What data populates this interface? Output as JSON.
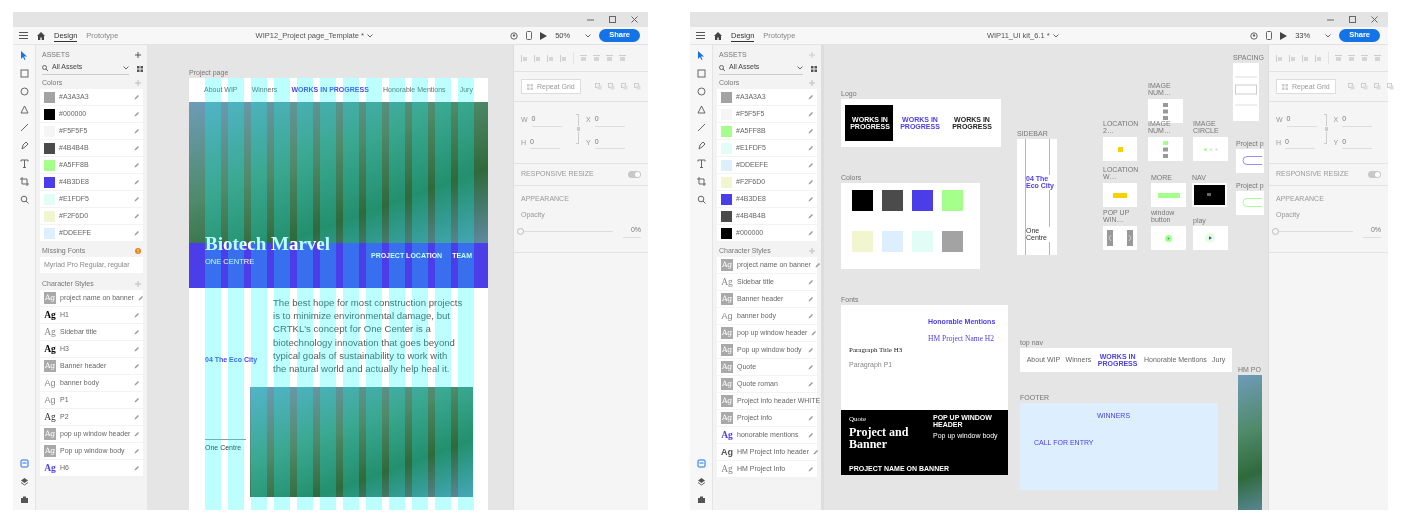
{
  "windows": [
    {
      "file_title": "WIP12_Project page_Template *",
      "zoom": "50%",
      "share": "Share",
      "tabs": [
        {
          "label": "Design",
          "selected": true
        },
        {
          "label": "Prototype",
          "selected": false
        }
      ],
      "assets": {
        "heading": "ASSETS",
        "filter": "All Assets",
        "colors_heading": "Colors",
        "colors": [
          {
            "label": "#A3A3A3",
            "color": "#a3a3a3"
          },
          {
            "label": "#000000",
            "color": "#000000"
          },
          {
            "label": "#F5F5F5",
            "color": "#f5f5f5"
          },
          {
            "label": "#4B4B4B",
            "color": "#4b4b4b"
          },
          {
            "label": "#A5FF8B",
            "color": "#a5ff8b"
          },
          {
            "label": "#4B3DE8",
            "color": "#4b3de8"
          },
          {
            "label": "#E1FDF5",
            "color": "#e1fdf5"
          },
          {
            "label": "#F2F6D0",
            "color": "#f2f6d0"
          },
          {
            "label": "#DDEEFE",
            "color": "#ddeefe"
          }
        ],
        "missing_fonts": {
          "heading": "Missing Fonts",
          "font": "Myriad Pro Regular, regular"
        },
        "styles_heading": "Character Styles",
        "styles": [
          {
            "preview": "Ag",
            "label": "project name on banner",
            "kind": "white"
          },
          {
            "preview": "Ag",
            "label": "H1",
            "kind": "serif-bold"
          },
          {
            "preview": "Ag",
            "label": "Sidebar title",
            "kind": "serif-light"
          },
          {
            "preview": "Ag",
            "label": "H3",
            "kind": "serif-bold"
          },
          {
            "preview": "Ag",
            "label": "Banner header",
            "kind": "white"
          },
          {
            "preview": "Ag",
            "label": "banner body",
            "kind": "sans-light"
          },
          {
            "preview": "Ag",
            "label": "P1",
            "kind": "sans-light"
          },
          {
            "preview": "Ag",
            "label": "P2",
            "kind": "serif"
          },
          {
            "preview": "Ag",
            "label": "pop up window header",
            "kind": "white"
          },
          {
            "preview": "Ag",
            "label": "Pop up window body",
            "kind": "white"
          },
          {
            "preview": "Ag",
            "label": "H6",
            "kind": "serif-blue"
          }
        ]
      },
      "properties": {
        "repeat_grid": "Repeat Grid",
        "fields": [
          {
            "label": "W",
            "value": "0"
          },
          {
            "label": "X",
            "value": "0"
          },
          {
            "label": "H",
            "value": "0"
          },
          {
            "label": "Y",
            "value": "0"
          }
        ],
        "responsive": {
          "label": "RESPONSIVE RESIZE",
          "on": true
        },
        "appearance": "APPEARANCE",
        "opacity": {
          "label": "Opacity",
          "value": "0%",
          "level": 0
        }
      },
      "canvas": {
        "kind": "project-page",
        "artboard_label": "Project page",
        "nav": [
          {
            "label": "About WIP",
            "kind": "link"
          },
          {
            "label": "Winners",
            "kind": "link"
          },
          {
            "label": "WORKS IN PROGRESS",
            "kind": "logo"
          },
          {
            "label": "Honorable Mentions",
            "kind": "link"
          },
          {
            "label": "Jury",
            "kind": "link"
          }
        ],
        "title": "Biotech Marvel",
        "subtitle": "ONE CENTRE",
        "info_headings": [
          "PROJECT LOCATION",
          "TEAM"
        ],
        "paragraph": "The best hope for most construction projects is to minimize environmental damage, but CRTKL's concept for One Center is a biotechnology innovation that goes beyond typical goals of sustainability to work with the natural world and actually help heal it.",
        "sidebar": [
          {
            "label": "04 The Eco City",
            "selected": true
          }
        ],
        "caption": "One Centre"
      }
    },
    {
      "file_title": "WIP11_UI kit_6.1 *",
      "zoom": "33%",
      "share": "Share",
      "tabs": [
        {
          "label": "Design",
          "selected": true
        },
        {
          "label": "Prototype",
          "selected": false
        }
      ],
      "assets": {
        "heading": "ASSETS",
        "filter": "All Assets",
        "colors_heading": "Colors",
        "colors": [
          {
            "label": "#A3A3A3",
            "color": "#a3a3a3"
          },
          {
            "label": "#F5F5F5",
            "color": "#f5f5f5"
          },
          {
            "label": "#A5FF8B",
            "color": "#a5ff8b"
          },
          {
            "label": "#E1FDF5",
            "color": "#e1fdf5"
          },
          {
            "label": "#DDEEFE",
            "color": "#ddeefe"
          },
          {
            "label": "#F2F6D0",
            "color": "#f2f6d0"
          },
          {
            "label": "#4B3DE8",
            "color": "#4b3de8"
          },
          {
            "label": "#4B4B4B",
            "color": "#4b4b4b"
          },
          {
            "label": "#000000",
            "color": "#000000"
          }
        ],
        "styles_heading": "Character Styles",
        "styles": [
          {
            "preview": "Ag",
            "label": "project name on banner",
            "kind": "white"
          },
          {
            "preview": "Ag",
            "label": "Sidebar title",
            "kind": "serif-light"
          },
          {
            "preview": "Ag",
            "label": "Banner header",
            "kind": "white"
          },
          {
            "preview": "Ag",
            "label": "banner body",
            "kind": "sans-light"
          },
          {
            "preview": "Ag",
            "label": "pop up window header",
            "kind": "white"
          },
          {
            "preview": "Ag",
            "label": "Pop up window body",
            "kind": "white"
          },
          {
            "preview": "Ag",
            "label": "Quote",
            "kind": "white"
          },
          {
            "preview": "Ag",
            "label": "Quote roman",
            "kind": "white"
          },
          {
            "preview": "Ag",
            "label": "Project info header WHITE",
            "kind": "white"
          },
          {
            "preview": "Ag",
            "label": "Project info",
            "kind": "white"
          },
          {
            "preview": "Ag",
            "label": "honorable mentions",
            "kind": "serif-blue"
          },
          {
            "preview": "Ag",
            "label": "HM Project Info header",
            "kind": "sans-dark"
          },
          {
            "preview": "Ag",
            "label": "HM Project Info",
            "kind": "serif-light"
          }
        ]
      },
      "properties": {
        "repeat_grid": "Repeat Grid",
        "fields": [
          {
            "label": "W",
            "value": "0"
          },
          {
            "label": "X",
            "value": "0"
          },
          {
            "label": "H",
            "value": "0"
          },
          {
            "label": "Y",
            "value": "0"
          }
        ],
        "responsive": {
          "label": "RESPONSIVE RESIZE",
          "on": true
        },
        "appearance": "APPEARANCE",
        "opacity": {
          "label": "Opacity",
          "value": "0%",
          "level": 0
        }
      },
      "canvas": {
        "kind": "ui-kit",
        "artboards": [
          {
            "kind": "logo",
            "label": "Logo",
            "logos": [
              "WORKS IN PROGRESS",
              "WORKS IN PROGRESS",
              "WORKS IN PROGRESS"
            ]
          },
          {
            "kind": "colors",
            "label": "Colors",
            "swatches": [
              {
                "color": "#000000"
              },
              {
                "color": "#4b4b4b"
              },
              {
                "color": "#4b3de8"
              },
              {
                "color": "#a5ff8b"
              },
              {
                "color": "#f2f6d0"
              },
              {
                "color": "#ddeefe"
              },
              {
                "color": "#e1fdf5"
              },
              {
                "color": "#a3a3a3"
              }
            ]
          },
          {
            "kind": "fonts",
            "label": "Fonts",
            "mentions": "Honorable Mentions",
            "hm_title": "HM Project Name H2",
            "h3": "Paragraph Title H3",
            "p1": "Paragraph P1",
            "quote": "Quote",
            "banner": "Project and Banner",
            "banner_sub": "PROJECT NAME ON BANNER",
            "popup_header": "POP UP WINDOW HEADER",
            "popup_body": "Pop up window body"
          },
          {
            "kind": "sidebar",
            "label": "SIDEBAR",
            "item": "04 The Eco City",
            "caption": "One Centre"
          },
          {
            "kind": "image-num",
            "label": "IMAGE NUM…"
          },
          {
            "kind": "location",
            "label": "LOCATION 2…"
          },
          {
            "kind": "image-num-active",
            "label": "IMAGE NUM…"
          },
          {
            "kind": "image-circle",
            "label": "IMAGE CIRCLE"
          },
          {
            "kind": "location-wide",
            "label": "LOCATION W…"
          },
          {
            "kind": "more",
            "label": "MORE"
          },
          {
            "kind": "nav",
            "label": "NAV"
          },
          {
            "kind": "popup",
            "label": "POP UP WIN…"
          },
          {
            "kind": "window-button",
            "label": "window button"
          },
          {
            "kind": "play",
            "label": "play"
          },
          {
            "kind": "topnav",
            "label": "top nav",
            "items": [
              "About WIP",
              "Winners",
              "WORKS IN PROGRESS",
              "Honorable Mentions",
              "Jury"
            ]
          },
          {
            "kind": "footer",
            "label": "FOOTER",
            "heading": "WINNERS",
            "cta": "CALL FOR ENTRY"
          },
          {
            "kind": "spacing",
            "label": "SPACING"
          },
          {
            "kind": "pill-purple",
            "label": "Project p"
          },
          {
            "kind": "pill-green",
            "label": "Project p"
          },
          {
            "kind": "photo",
            "label": "HM PO"
          }
        ]
      }
    }
  ]
}
